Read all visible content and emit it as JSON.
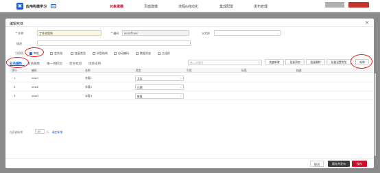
{
  "app": {
    "name": "应用构建学习",
    "tag": "UI"
  },
  "topnav": [
    {
      "label": "对象建模",
      "active": true
    },
    {
      "label": "页面建模",
      "active": false
    },
    {
      "label": "流程&自动化",
      "active": false
    },
    {
      "label": "集成配置",
      "active": false
    },
    {
      "label": "发布管理",
      "active": false
    }
  ],
  "modal": {
    "title": "编辑实体",
    "close": "×",
    "fields": {
      "name_label": "名称",
      "name_value": "工作流案例",
      "code_label": "编码",
      "code_value": "workflows",
      "parent_label": "父实体",
      "parent_value": "",
      "desc_label": "描述",
      "desc_value": "",
      "ref_label": "引用项"
    },
    "checkboxes": [
      {
        "label": "审批",
        "checked": true
      },
      {
        "label": "会务流",
        "checked": false
      },
      {
        "label": "变更类型",
        "checked": false
      },
      {
        "label": "树型结构",
        "checked": false
      },
      {
        "label": "自动编码",
        "checked": false
      },
      {
        "label": "数据状态",
        "checked": false
      },
      {
        "label": "主组织",
        "checked": false
      }
    ],
    "tabs": [
      {
        "label": "业务属性",
        "active": true
      },
      {
        "label": "系统属性",
        "active": false
      },
      {
        "label": "唯一性校验",
        "active": false
      },
      {
        "label": "密空校验",
        "active": false
      },
      {
        "label": "场景支持",
        "active": false
      }
    ],
    "search_placeholder": "输入关键词",
    "toolbar": {
      "quick_add": "快速新增",
      "batch_add": "批量添加",
      "batch_delete": "批量删除",
      "batch_type": "批量设置类型",
      "add": "新增"
    },
    "table": {
      "headers": [
        "序号",
        "编码",
        "名称",
        "类型",
        "引用",
        "标签",
        "描述"
      ],
      "rows": [
        {
          "no": "1",
          "code": "new1",
          "name": "字段1",
          "type": "文本"
        },
        {
          "no": "2",
          "code": "new2",
          "name": "字段2",
          "type": "日期"
        },
        {
          "no": "3",
          "code": "new3",
          "name": "字段3",
          "type": "数值"
        }
      ]
    },
    "pager": {
      "prefix": "在表格新增",
      "count": "10",
      "unit": "行",
      "link": "确定新增"
    },
    "footer": {
      "cancel": "取消",
      "save_publish": "保存并发布",
      "save": "保存"
    }
  },
  "colors": {
    "accent": "#1a63d6",
    "danger": "#d9001b",
    "annotation": "#e21b1b"
  }
}
